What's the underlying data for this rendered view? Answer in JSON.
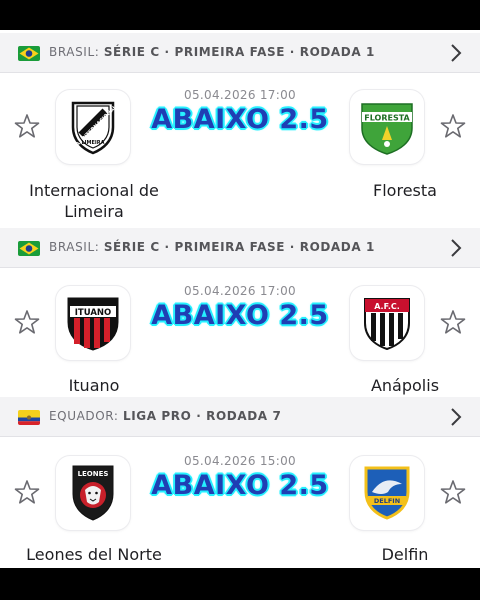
{
  "matches": [
    {
      "league": {
        "country": "BRASIL:",
        "competition": "SÉRIE C · PRIMEIRA FASE · RODADA 1",
        "flag": "brazil-flag"
      },
      "datetime": "05.04.2026 17:00",
      "overlay": "ABAIXO 2.5",
      "home": {
        "name": "Internacional de Limeira",
        "logo_icon": "internacional-limeira-crest-icon",
        "logo_text": "A.A. INTERNACIONAL",
        "logo_sub": "LIMEIRA"
      },
      "away": {
        "name": "Floresta",
        "logo_icon": "floresta-crest-icon",
        "logo_text": "FLORESTA"
      }
    },
    {
      "league": {
        "country": "BRASIL:",
        "competition": "SÉRIE C · PRIMEIRA FASE · RODADA 1",
        "flag": "brazil-flag"
      },
      "datetime": "05.04.2026 17:00",
      "overlay": "ABAIXO 2.5",
      "home": {
        "name": "Ituano",
        "logo_icon": "ituano-crest-icon",
        "logo_text": "ITUANO"
      },
      "away": {
        "name": "Anápolis",
        "logo_icon": "anapolis-crest-icon",
        "logo_text": "A.F.C."
      }
    },
    {
      "league": {
        "country": "EQUADOR:",
        "competition": "LIGA PRO · RODADA 7",
        "flag": "ecuador-flag"
      },
      "datetime": "05.04.2026 15:00",
      "overlay": "ABAIXO 2.5",
      "home": {
        "name": "Leones del Norte",
        "logo_icon": "leones-del-norte-crest-icon",
        "logo_text": "LEONES"
      },
      "away": {
        "name": "Delfin",
        "logo_icon": "delfin-crest-icon",
        "logo_text": "DELFIN"
      }
    }
  ],
  "colors": {
    "overlay_text": "#1f3fb4",
    "overlay_glow": "#27f0ff",
    "league_bar": "#f3f3f5"
  }
}
